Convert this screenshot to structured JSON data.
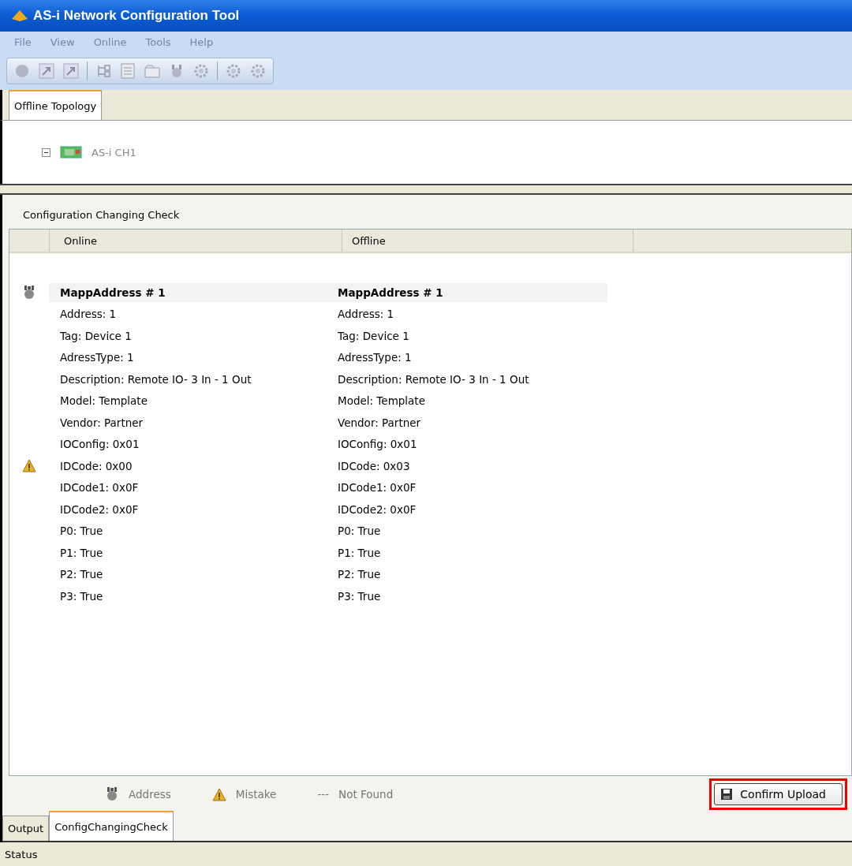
{
  "window": {
    "title": "AS-i Network Configuration Tool"
  },
  "menu": [
    {
      "label": "File",
      "disabled": true
    },
    {
      "label": "View",
      "disabled": true
    },
    {
      "label": "Online",
      "disabled": true
    },
    {
      "label": "Tools",
      "disabled": true
    },
    {
      "label": "Help",
      "disabled": true
    }
  ],
  "top_tabs": [
    {
      "label": "Offline Topology",
      "selected": true
    }
  ],
  "tree": {
    "expanded": true,
    "label": "AS-i CH1"
  },
  "section_title": "Configuration Changing Check",
  "table": {
    "columns": [
      "Online",
      "Offline"
    ],
    "rows": [
      {
        "kind": "header",
        "address_icon": true,
        "warning": false,
        "online": "MappAddress # 1",
        "offline": "MappAddress # 1"
      },
      {
        "kind": "field",
        "address_icon": false,
        "warning": false,
        "online": "Address: 1",
        "offline": "Address: 1"
      },
      {
        "kind": "field",
        "address_icon": false,
        "warning": false,
        "online": "Tag: Device 1",
        "offline": "Tag: Device 1"
      },
      {
        "kind": "field",
        "address_icon": false,
        "warning": false,
        "online": "AdressType: 1",
        "offline": "AdressType: 1"
      },
      {
        "kind": "field",
        "address_icon": false,
        "warning": false,
        "online": "Description: Remote IO- 3 In - 1 Out",
        "offline": "Description: Remote IO- 3 In - 1 Out"
      },
      {
        "kind": "field",
        "address_icon": false,
        "warning": false,
        "online": "Model: Template",
        "offline": "Model: Template"
      },
      {
        "kind": "field",
        "address_icon": false,
        "warning": false,
        "online": "Vendor: Partner",
        "offline": "Vendor: Partner"
      },
      {
        "kind": "field",
        "address_icon": false,
        "warning": false,
        "online": "IOConfig: 0x01",
        "offline": "IOConfig: 0x01"
      },
      {
        "kind": "field",
        "address_icon": false,
        "warning": true,
        "online": "IDCode: 0x00",
        "offline": "IDCode: 0x03"
      },
      {
        "kind": "field",
        "address_icon": false,
        "warning": false,
        "online": "IDCode1: 0x0F",
        "offline": "IDCode1: 0x0F"
      },
      {
        "kind": "field",
        "address_icon": false,
        "warning": false,
        "online": "IDCode2: 0x0F",
        "offline": "IDCode2: 0x0F"
      },
      {
        "kind": "field",
        "address_icon": false,
        "warning": false,
        "online": "P0: True",
        "offline": "P0: True"
      },
      {
        "kind": "field",
        "address_icon": false,
        "warning": false,
        "online": "P1: True",
        "offline": "P1: True"
      },
      {
        "kind": "field",
        "address_icon": false,
        "warning": false,
        "online": "P2: True",
        "offline": "P2: True"
      },
      {
        "kind": "field",
        "address_icon": false,
        "warning": false,
        "online": "P3: True",
        "offline": "P3: True"
      }
    ]
  },
  "legend": [
    {
      "kind": "address",
      "label": "Address"
    },
    {
      "kind": "mistake",
      "label": "Mistake"
    },
    {
      "kind": "notfound",
      "symbol": "---",
      "label": "Not Found"
    }
  ],
  "confirm_button": {
    "label": "Confirm Upload",
    "highlighted": true
  },
  "bottom_tabs": [
    {
      "label": "Output",
      "selected": false
    },
    {
      "label": "ConfigChangingCheck",
      "selected": true
    }
  ],
  "status_bar": "Status"
}
